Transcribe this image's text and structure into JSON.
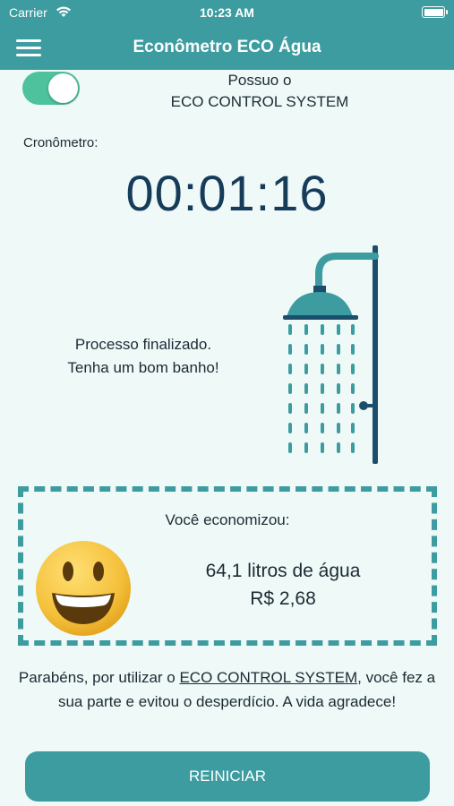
{
  "status_bar": {
    "carrier": "Carrier",
    "time": "10:23 AM"
  },
  "header": {
    "title": "Econômetro ECO Água",
    "menu_icon": "hamburger-menu-icon"
  },
  "eco_toggle": {
    "enabled": true,
    "label_line1": "Possuo o",
    "label_line2": "ECO CONTROL SYSTEM"
  },
  "timer": {
    "label": "Cronômetro:",
    "value": "00:01:16"
  },
  "status": {
    "line1": "Processo finalizado.",
    "line2": "Tenha um bom banho!"
  },
  "savings": {
    "heading": "Você economizou:",
    "liters": "64,1 litros de água",
    "money": "R$ 2,68"
  },
  "message": {
    "prefix": "Parabéns, por utilizar o ",
    "link": "ECO CONTROL SYSTEM",
    "suffix": ", você fez a sua parte e evitou o desperdício. A vida agradece!"
  },
  "actions": {
    "restart_label": "REINICIAR"
  },
  "colors": {
    "primary": "#3d9ca0",
    "toggle_on": "#4ec29c",
    "background": "#eef9f8",
    "timer_text": "#163c5a",
    "shower": "#1b4e6b"
  }
}
